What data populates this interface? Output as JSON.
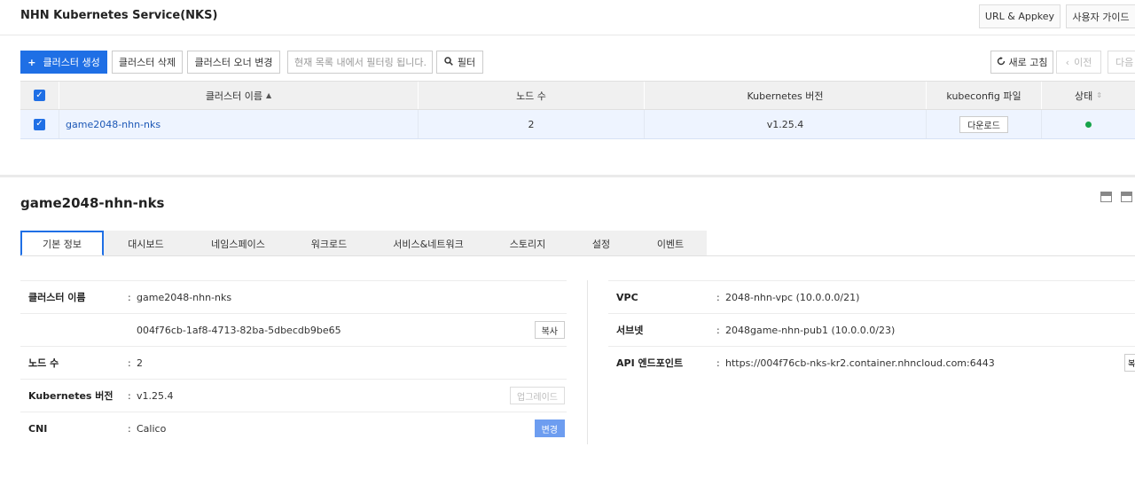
{
  "header": {
    "title": "NHN Kubernetes Service(NKS)",
    "url_appkey_label": "URL & Appkey",
    "user_guide_label": "사용자 가이드"
  },
  "toolbar": {
    "create_label": "클러스터 생성",
    "create_prefix": "+",
    "delete_label": "클러스터 삭제",
    "owner_change_label": "클러스터 오너 변경",
    "filter_placeholder": "현재 목록 내에서 필터링 됩니다.",
    "filter_button_label": "필터",
    "refresh_label": "새로 고침",
    "prev_label": "이전",
    "next_label": "다음"
  },
  "cluster_table": {
    "columns": [
      "클러스터 이름",
      "노드 수",
      "Kubernetes 버전",
      "kubeconfig 파일",
      "상태"
    ],
    "rows": [
      {
        "name": "game2048-nhn-nks",
        "nodes": "2",
        "version": "v1.25.4",
        "kubeconfig": "다운로드",
        "status": "running",
        "status_color": "#16a34a",
        "checked": true
      }
    ]
  },
  "detail": {
    "title": "game2048-nhn-nks",
    "tabs": [
      "기본 정보",
      "대시보드",
      "네임스페이스",
      "워크로드",
      "서비스&네트워크",
      "스토리지",
      "설정",
      "이벤트"
    ],
    "active_tab": "기본 정보",
    "left": {
      "cluster_name_label": "클러스터 이름",
      "cluster_name": "game2048-nhn-nks",
      "cluster_uuid": "004f76cb-1af8-4713-82ba-5dbecdb9be65",
      "copy_label": "복사",
      "nodes_label": "노드 수",
      "nodes": "2",
      "version_label": "Kubernetes 버전",
      "version": "v1.25.4",
      "upgrade_label": "업그레이드",
      "cni_label": "CNI",
      "cni": "Calico",
      "change_label": "변경"
    },
    "right": {
      "vpc_label": "VPC",
      "vpc": "2048-nhn-vpc (10.0.0.0/21)",
      "subnet_label": "서브넷",
      "subnet": "2048game-nhn-pub1 (10.0.0.0/23)",
      "api_label": "API 엔드포인트",
      "api": "https://004f76cb-nks-kr2.container.nhncloud.com:6443",
      "api_button_partial": "복"
    }
  },
  "colors": {
    "accent": "#1f6fe5",
    "link": "#1c57b5",
    "status_ok": "#16a34a"
  }
}
